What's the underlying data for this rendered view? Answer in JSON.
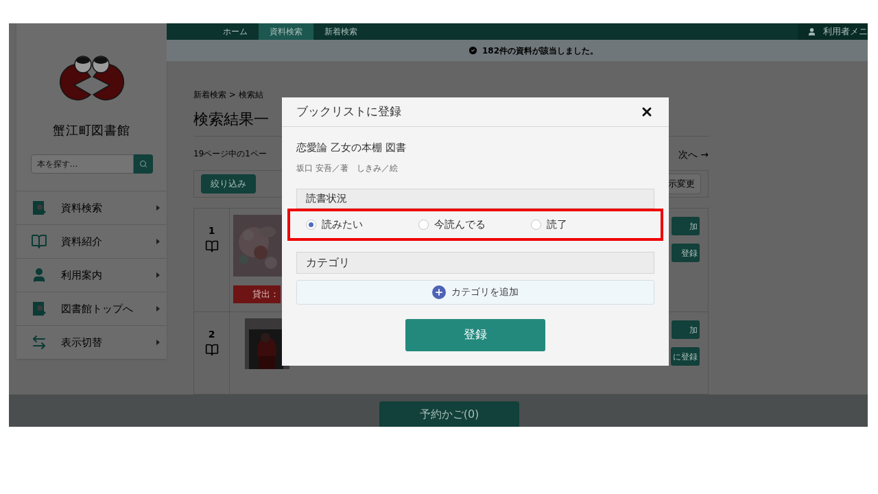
{
  "nav": {
    "items": [
      {
        "label": "ホーム",
        "selected": false
      },
      {
        "label": "資料検索",
        "selected": true
      },
      {
        "label": "新着検索",
        "selected": false
      }
    ],
    "user_menu": "利用者メニ"
  },
  "sidebar": {
    "library_name": "蟹江町図書館",
    "search": {
      "placeholder": "本を探す…"
    },
    "items": [
      {
        "label": "資料検索",
        "kind": "search-book"
      },
      {
        "label": "資料紹介",
        "kind": "open-book"
      },
      {
        "label": "利用案内",
        "kind": "person"
      },
      {
        "label": "図書館トップへ",
        "kind": "search-book"
      },
      {
        "label": "表示切替",
        "kind": "arrows"
      }
    ]
  },
  "notice": "182件の資料が該当しました。",
  "content": {
    "breadcrumb": "新着検索 > 検索結",
    "heading": "検索結果一",
    "page_info": "19ページ中の1ペー",
    "next": "次へ →",
    "filter_button": "絞り込み",
    "display_button": "示変更",
    "results": [
      {
        "number": "1",
        "status": "貸出：",
        "buttons": [
          "加",
          "登録"
        ]
      },
      {
        "number": "2",
        "buttons": [
          "加",
          "に登録"
        ]
      }
    ]
  },
  "cart_button": "予約かご(0)",
  "dialog": {
    "title": "ブックリストに登録",
    "book_title": "恋愛論 乙女の本棚 図書",
    "authors": "坂口 安吾／著　しきみ／絵",
    "status_section": {
      "label": "読書状況",
      "options": [
        {
          "label": "読みたい",
          "selected": true
        },
        {
          "label": "今読んでる",
          "selected": false
        },
        {
          "label": "読了",
          "selected": false
        }
      ]
    },
    "category_section": {
      "label": "カテゴリ",
      "add_button": "カテゴリを追加"
    },
    "submit": "登録"
  }
}
